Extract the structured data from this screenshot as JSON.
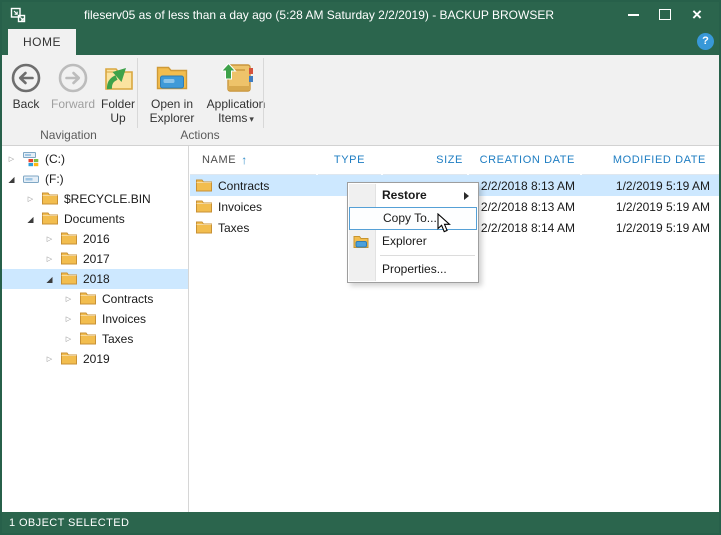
{
  "window": {
    "title": "fileserv05 as of less than a day ago (5:28 AM Saturday 2/2/2019) - BACKUP BROWSER",
    "icon": "backup-browser-icon",
    "help_glyph": "?",
    "controls": {
      "close_glyph": "×"
    }
  },
  "ribbon": {
    "tab_label": "HOME",
    "groups": [
      {
        "label": "Navigation",
        "buttons": [
          {
            "label": "Back",
            "icon": "back-arrow-circle-icon",
            "disabled": false
          },
          {
            "label": "Forward",
            "icon": "forward-arrow-circle-icon",
            "disabled": true
          },
          {
            "label": "Folder Up",
            "icon": "folder-up-icon",
            "disabled": false
          }
        ]
      },
      {
        "label": "Actions",
        "buttons": [
          {
            "label": "Open in Explorer",
            "icon": "open-in-explorer-icon",
            "disabled": false
          },
          {
            "label": "Application Items",
            "icon": "application-items-icon",
            "caret": "▾",
            "disabled": false
          }
        ]
      }
    ]
  },
  "tree": {
    "collapsed_glyph": "▷",
    "expanded_glyph": "◢",
    "items": [
      {
        "label": "(C:)",
        "level": 0,
        "state": "collapsed",
        "icon": "system-drive",
        "selected": false
      },
      {
        "label": "(F:)",
        "level": 0,
        "state": "expanded",
        "icon": "drive",
        "selected": false
      },
      {
        "label": "$RECYCLE.BIN",
        "level": 1,
        "state": "collapsed",
        "icon": "folder",
        "selected": false
      },
      {
        "label": "Documents",
        "level": 1,
        "state": "expanded",
        "icon": "folder",
        "selected": false
      },
      {
        "label": "2016",
        "level": 2,
        "state": "collapsed",
        "icon": "folder",
        "selected": false
      },
      {
        "label": "2017",
        "level": 2,
        "state": "collapsed",
        "icon": "folder",
        "selected": false
      },
      {
        "label": "2018",
        "level": 2,
        "state": "expanded",
        "icon": "folder",
        "selected": true
      },
      {
        "label": "Contracts",
        "level": 3,
        "state": "collapsed",
        "icon": "folder",
        "selected": false
      },
      {
        "label": "Invoices",
        "level": 3,
        "state": "collapsed",
        "icon": "folder",
        "selected": false
      },
      {
        "label": "Taxes",
        "level": 3,
        "state": "collapsed",
        "icon": "folder",
        "selected": false
      },
      {
        "label": "2019",
        "level": 2,
        "state": "collapsed",
        "icon": "folder",
        "selected": false
      }
    ]
  },
  "file_list": {
    "columns": [
      "NAME",
      "TYPE",
      "SIZE",
      "CREATION DATE",
      "MODIFIED DATE"
    ],
    "sort": {
      "column": "NAME",
      "direction": "ascending",
      "arrow_glyph": "↑"
    },
    "rows": [
      {
        "name": "Contracts",
        "type": "",
        "size": "",
        "creation_date": "2/2/2018 8:13 AM",
        "modified_date": "1/2/2019 5:19 AM",
        "selected": true
      },
      {
        "name": "Invoices",
        "type": "",
        "size": "",
        "creation_date": "2/2/2018 8:13 AM",
        "modified_date": "1/2/2019 5:19 AM",
        "selected": false
      },
      {
        "name": "Taxes",
        "type": "",
        "size": "",
        "creation_date": "2/2/2018 8:14 AM",
        "modified_date": "1/2/2019 5:19 AM",
        "selected": false
      }
    ]
  },
  "context_menu": {
    "items": [
      {
        "label": "Restore",
        "bold": true,
        "has_submenu": true
      },
      {
        "label": "Copy To...",
        "highlighted": true
      },
      {
        "label": "Explorer",
        "icon": "explorer-folder-icon"
      },
      {
        "label": "Properties..."
      }
    ]
  },
  "status_bar": {
    "text": "1 OBJECT SELECTED"
  },
  "colors": {
    "titlebar_green": "#2b654d",
    "header_text_blue": "#1e7dc2",
    "selection_blue": "#cde8ff",
    "menu_highlight_border": "#55a0d6"
  }
}
